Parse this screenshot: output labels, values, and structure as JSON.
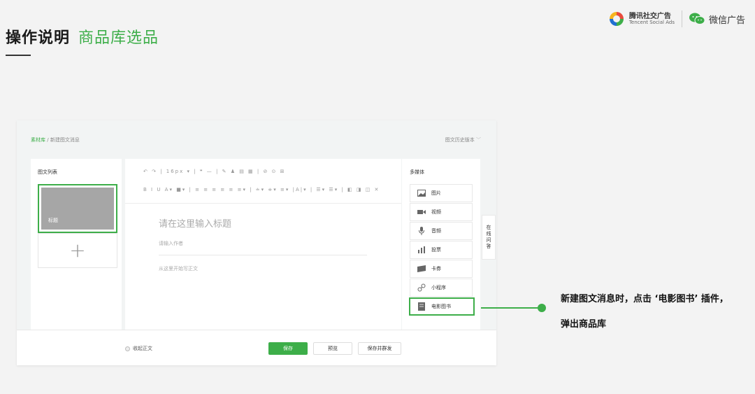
{
  "slide": {
    "title_main": "操作说明",
    "title_sub": "商品库选品"
  },
  "brand": {
    "tencent_cn": "腾讯社交广告",
    "tencent_en": "Tencent Social Ads",
    "wechat_ads": "微信广告",
    "colors": {
      "green": "#3dae49",
      "blue": "#1f6fd1",
      "red": "#e94b3c",
      "yellow": "#f6b51e"
    }
  },
  "editor": {
    "breadcrumb": {
      "root": "素材库",
      "separator": "/",
      "current": "新建图文消息"
    },
    "history_label": "图文历史版本",
    "article_list": {
      "header": "图文列表",
      "thumb_label": "标题",
      "add_symbol": "+"
    },
    "toolbar": {
      "row1": "↶ ↷ | 16px ▾ | ❝ — | ✎ ♟ ▤ ▦ | ⊘ ⊙ ⊞",
      "row2": "B I U A▾ ■▾ | ≡ ≡ ≡ ≡ ≡ ≡▾ | ≐▾ ≑▾ ≡▾ |A|▾ | ☰▾ ☰▾ | ◧ ◨ ◫ ✕"
    },
    "content": {
      "title_placeholder": "请在这里输入标题",
      "author_placeholder": "请输入作者",
      "body_placeholder": "从这里开始写正文"
    },
    "multimedia": {
      "header": "多媒体",
      "items": [
        {
          "label": "图片",
          "icon": "image-icon"
        },
        {
          "label": "视频",
          "icon": "video-icon"
        },
        {
          "label": "音频",
          "icon": "microphone-icon"
        },
        {
          "label": "投票",
          "icon": "bar-chart-icon"
        },
        {
          "label": "卡券",
          "icon": "ticket-icon"
        },
        {
          "label": "小程序",
          "icon": "link-icon"
        },
        {
          "label": "电影图书",
          "icon": "book-icon"
        }
      ]
    },
    "qa_tab": [
      "在",
      "线",
      "问",
      "答"
    ],
    "footer": {
      "collapse_label": "收起正文",
      "save": "保存",
      "preview": "预览",
      "save_and_send": "保存并群发"
    }
  },
  "callout": {
    "text": "新建图文消息时，点击 ‘电影图书’ 插件，弹出商品库"
  }
}
